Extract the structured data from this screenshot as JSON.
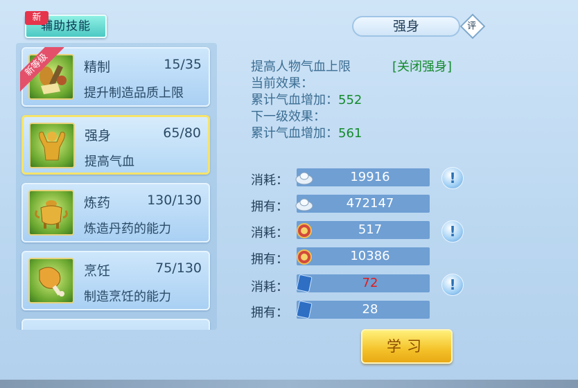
{
  "header": {
    "tab_label": "辅助技能",
    "tab_badge": "新",
    "title": "强身",
    "eval_badge": "评"
  },
  "skills": [
    {
      "name": "精制",
      "level": "15/35",
      "desc": "提升制造品质上限",
      "ribbon": "新等级",
      "icon": "crafting-tools-icon"
    },
    {
      "name": "强身",
      "level": "65/80",
      "desc": "提高气血",
      "icon": "muscle-man-icon",
      "selected": true
    },
    {
      "name": "炼药",
      "level": "130/130",
      "desc": "炼造丹药的能力",
      "icon": "alchemy-cauldron-icon"
    },
    {
      "name": "烹饪",
      "level": "75/130",
      "desc": "制造烹饪的能力",
      "icon": "roast-leg-icon"
    }
  ],
  "detail": {
    "description": "提高人物气血上限",
    "toggle": "[关闭强身]",
    "current_label": "当前效果：",
    "current_effect_label": "累计气血增加：",
    "current_effect_value": "552",
    "next_label": "下一级效果：",
    "next_effect_label": "累计气血增加：",
    "next_effect_value": "561"
  },
  "resources": [
    {
      "label": "消耗：",
      "value": "19916",
      "icon": "silver-ingot-icon",
      "alert": true
    },
    {
      "label": "拥有：",
      "value": "472147",
      "icon": "silver-ingot-icon"
    },
    {
      "label": "消耗：",
      "value": "517",
      "icon": "contribution-medal-icon",
      "alert": true
    },
    {
      "label": "拥有：",
      "value": "10386",
      "icon": "contribution-medal-icon"
    },
    {
      "label": "消耗：",
      "value": "72",
      "icon": "energy-book-icon",
      "alert": true,
      "insufficient": true
    },
    {
      "label": "拥有：",
      "value": "28",
      "icon": "energy-book-icon"
    }
  ],
  "alert_symbol": "!",
  "learn_button": "学习",
  "colors": {
    "accent_green": "#138a2c",
    "insufficient_red": "#e21b1b",
    "button_gold": "#f4c22a"
  }
}
